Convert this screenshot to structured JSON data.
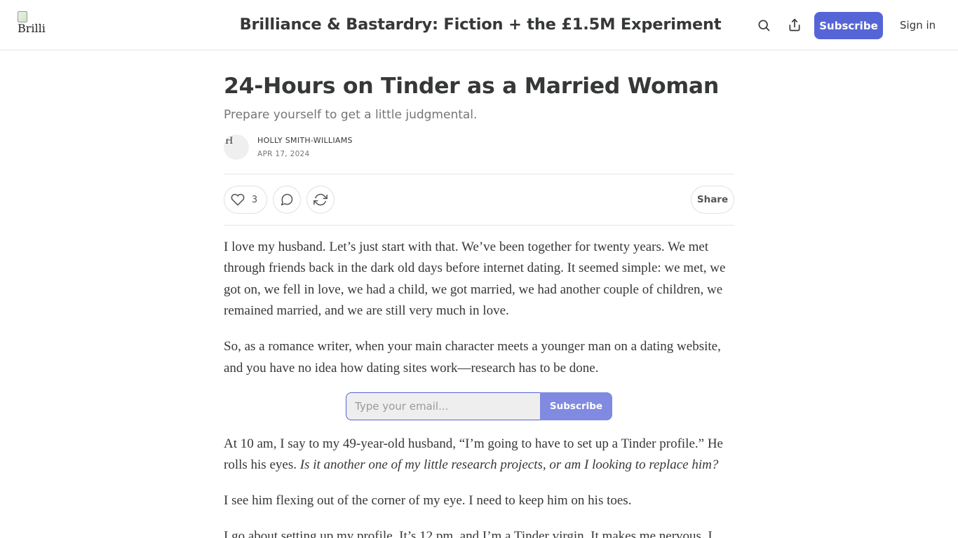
{
  "header": {
    "logo_alt": "Brilli",
    "publication_title": "Brilliance & Bastardry: Fiction + the £1.5M Experiment",
    "subscribe_label": "Subscribe",
    "signin_label": "Sign in"
  },
  "post": {
    "title": "24-Hours on Tinder as a Married Woman",
    "subtitle": "Prepare yourself to get a little judgmental.",
    "author": "HOLLY SMITH-WILLIAMS",
    "avatar_alt": "H",
    "date": "APR 17, 2024",
    "like_count": "3",
    "share_label": "Share"
  },
  "body": {
    "p1": "I love my husband. Let’s just start with that. We’ve been together for twenty years. We met through friends back in the dark old days before internet dating. It seemed simple: we met, we got on, we fell in love, we had a child, we got married, we had another couple of children, we remained married, and we are still very much in love.",
    "p2": "So, as a romance writer, when your main character meets a younger man on a dating website, and you have no idea how dating sites work—research has to be done.",
    "p3_start": "At 10 am, I say to my 49-year-old husband, “I’m going to have to set up a Tinder profile.” He rolls his eyes. ",
    "p3_italic": "Is it another one of my little research projects, or am I looking to replace him?",
    "p4": "I see him flexing out of the corner of my eye. I need to keep him on his toes.",
    "p5": "I go about setting up my profile. It’s 12 pm, and I’m a Tinder virgin. It makes me nervous. I"
  },
  "subscribe_form": {
    "placeholder": "Type your email...",
    "button_label": "Subscribe"
  },
  "colors": {
    "accent": "#5665d6",
    "accent_light": "#7f8ae0",
    "text": "#363737",
    "muted": "#757575"
  }
}
